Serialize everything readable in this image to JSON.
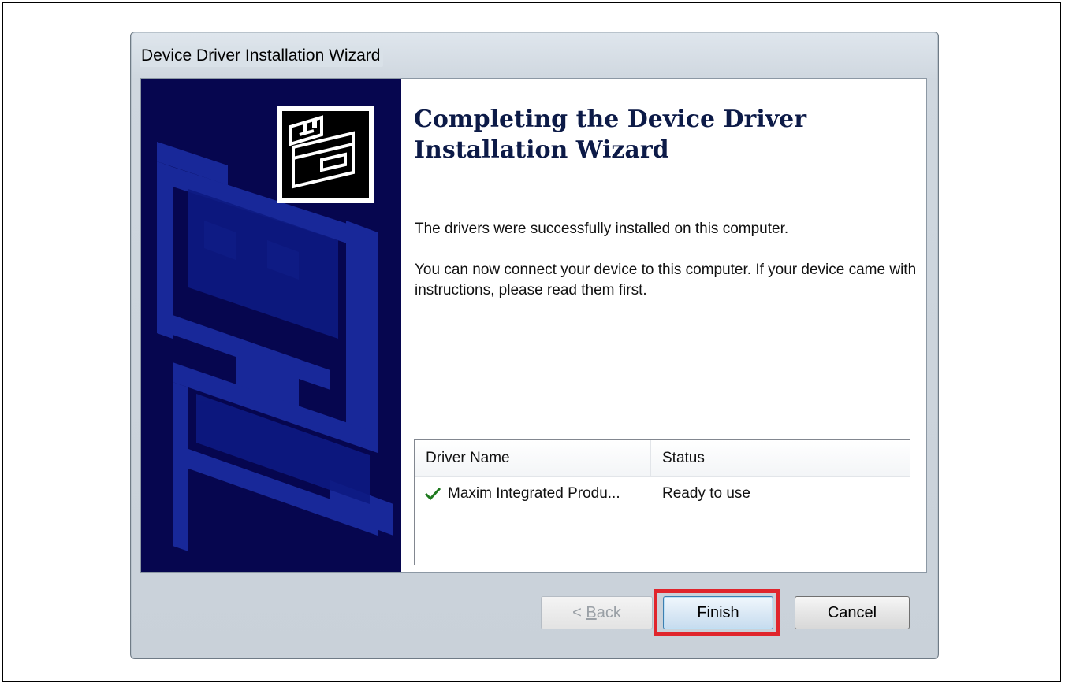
{
  "window": {
    "title": "Device Driver Installation Wizard"
  },
  "banner": {
    "logo_icon": "hardware-install-icon"
  },
  "main": {
    "heading": "Completing the Device Driver Installation Wizard",
    "success_message": "The drivers were successfully installed on this computer.",
    "instructions": "You can now connect your device to this computer. If your device came with instructions, please read them first."
  },
  "driver_table": {
    "columns": [
      "Driver Name",
      "Status"
    ],
    "rows": [
      {
        "icon": "checkmark-icon",
        "name": "Maxim Integrated Produ...",
        "status": "Ready to use"
      }
    ]
  },
  "buttons": {
    "back_prefix": "< ",
    "back_accel": "B",
    "back_rest": "ack",
    "finish": "Finish",
    "cancel": "Cancel"
  },
  "colors": {
    "banner_bg": "#06064f",
    "highlight": "#e0252c",
    "check": "#1f7a1f"
  }
}
